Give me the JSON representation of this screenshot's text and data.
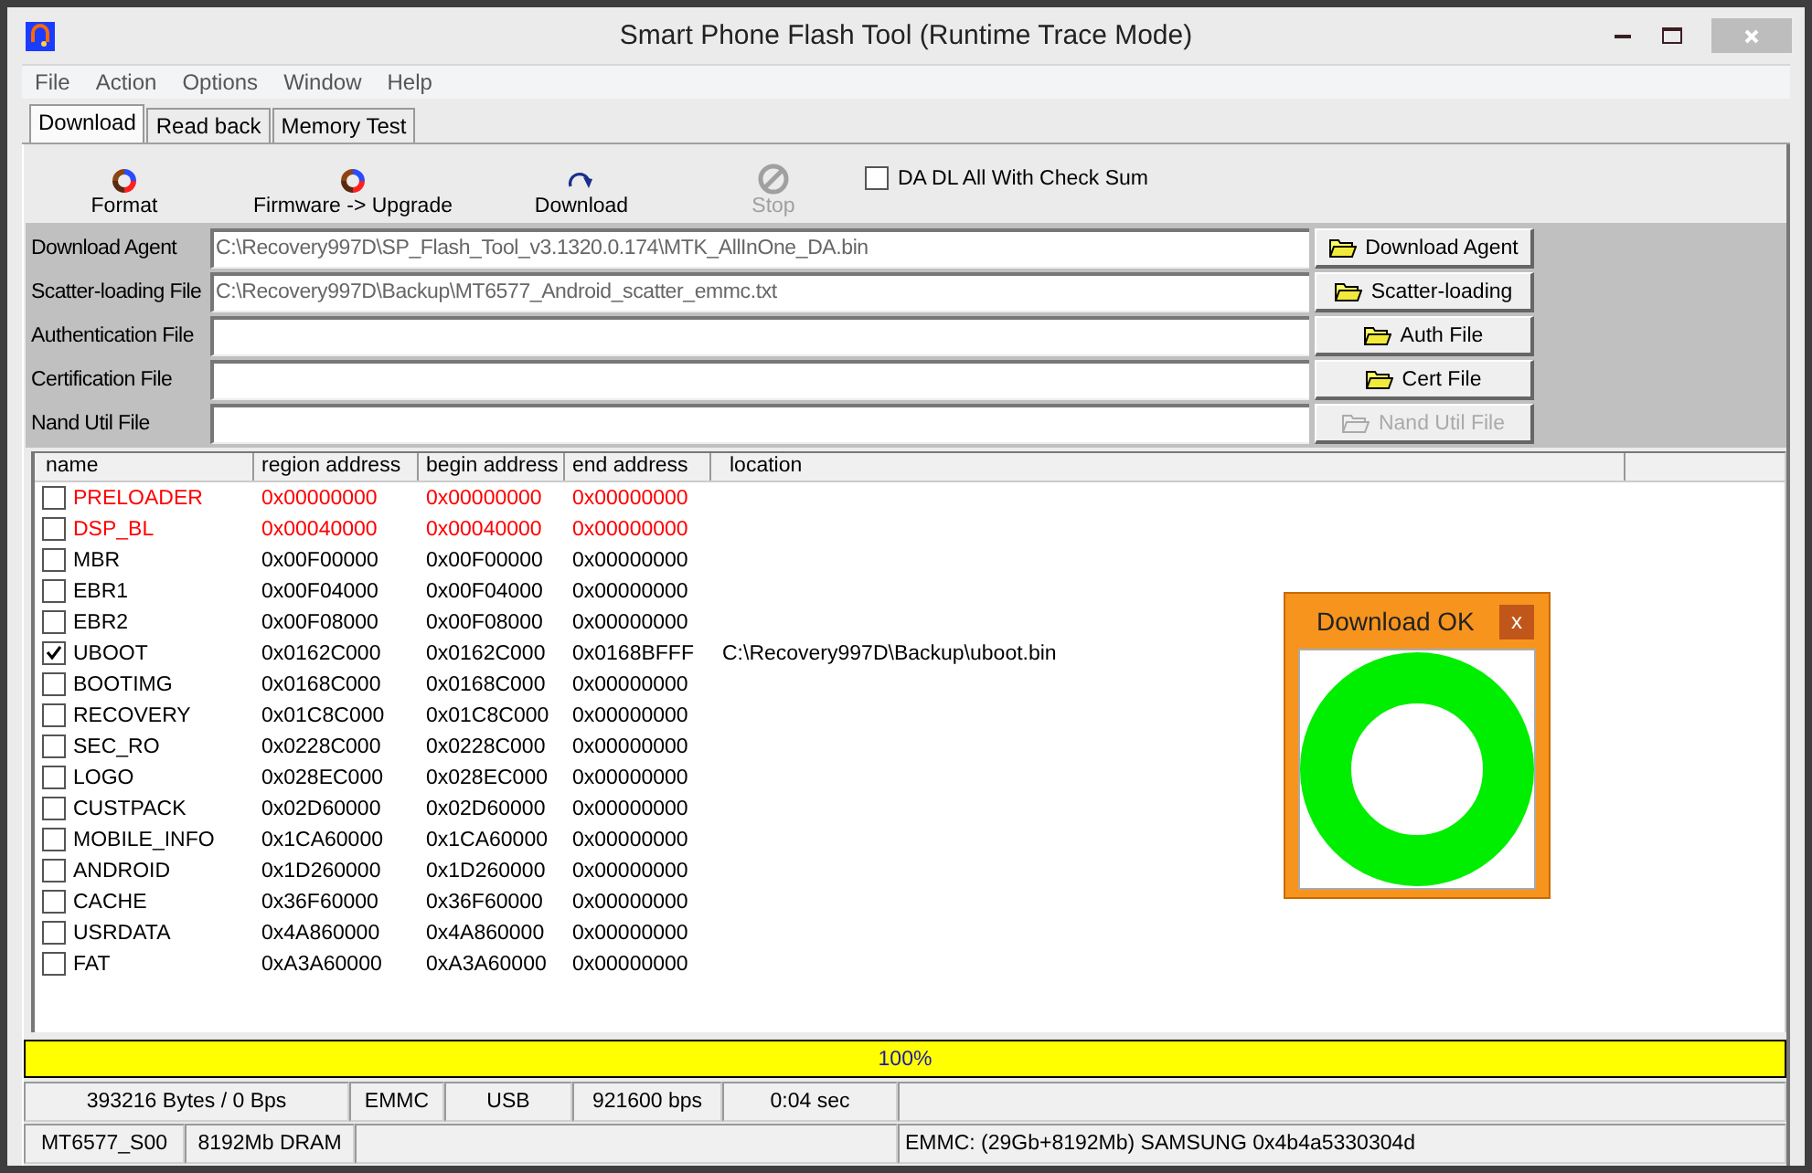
{
  "window": {
    "title": "Smart Phone Flash Tool (Runtime Trace Mode)"
  },
  "menu": [
    "File",
    "Action",
    "Options",
    "Window",
    "Help"
  ],
  "tabs": [
    {
      "label": "Download",
      "selected": true
    },
    {
      "label": "Read back",
      "selected": false
    },
    {
      "label": "Memory Test",
      "selected": false
    }
  ],
  "toolbar": [
    {
      "label": "Format",
      "kind": "format",
      "disabled": false
    },
    {
      "label": "Firmware -> Upgrade",
      "kind": "upgrade",
      "disabled": false
    },
    {
      "label": "Download",
      "kind": "download",
      "disabled": false
    },
    {
      "label": "Stop",
      "kind": "stop",
      "disabled": true
    }
  ],
  "checksum": {
    "label": "DA DL All With Check Sum",
    "checked": false
  },
  "files": [
    {
      "label": "Download Agent",
      "value": "C:\\Recovery997D\\SP_Flash_Tool_v3.1320.0.174\\MTK_AllInOne_DA.bin",
      "button": "Download Agent",
      "disabled": false
    },
    {
      "label": "Scatter-loading File",
      "value": "C:\\Recovery997D\\Backup\\MT6577_Android_scatter_emmc.txt",
      "button": "Scatter-loading",
      "disabled": false
    },
    {
      "label": "Authentication File",
      "button": "Auth File",
      "disabled": false
    },
    {
      "label": "Certification File",
      "button": "Cert File",
      "disabled": false
    },
    {
      "label": "Nand Util File",
      "button": "Nand Util File",
      "disabled": true
    }
  ],
  "table": {
    "columns": [
      "name",
      "region address",
      "begin address",
      "end address",
      "location"
    ],
    "rows": [
      {
        "name": "PRELOADER",
        "region": "0x00000000",
        "begin": "0x00000000",
        "end": "0x00000000",
        "checked": false,
        "color": "#ff0000"
      },
      {
        "name": "DSP_BL",
        "region": "0x00040000",
        "begin": "0x00040000",
        "end": "0x00000000",
        "checked": false,
        "color": "#ff0000"
      },
      {
        "name": "MBR",
        "region": "0x00F00000",
        "begin": "0x00F00000",
        "end": "0x00000000",
        "checked": false,
        "color": "#000000"
      },
      {
        "name": "EBR1",
        "region": "0x00F04000",
        "begin": "0x00F04000",
        "end": "0x00000000",
        "checked": false,
        "color": "#000000"
      },
      {
        "name": "EBR2",
        "region": "0x00F08000",
        "begin": "0x00F08000",
        "end": "0x00000000",
        "checked": false,
        "color": "#000000"
      },
      {
        "name": "UBOOT",
        "region": "0x0162C000",
        "begin": "0x0162C000",
        "end": "0x0168BFFF",
        "location": "C:\\Recovery997D\\Backup\\uboot.bin",
        "checked": true,
        "color": "#000000"
      },
      {
        "name": "BOOTIMG",
        "region": "0x0168C000",
        "begin": "0x0168C000",
        "end": "0x00000000",
        "checked": false,
        "color": "#000000"
      },
      {
        "name": "RECOVERY",
        "region": "0x01C8C000",
        "begin": "0x01C8C000",
        "end": "0x00000000",
        "checked": false,
        "color": "#000000"
      },
      {
        "name": "SEC_RO",
        "region": "0x0228C000",
        "begin": "0x0228C000",
        "end": "0x00000000",
        "checked": false,
        "color": "#000000"
      },
      {
        "name": "LOGO",
        "region": "0x028EC000",
        "begin": "0x028EC000",
        "end": "0x00000000",
        "checked": false,
        "color": "#000000"
      },
      {
        "name": "CUSTPACK",
        "region": "0x02D60000",
        "begin": "0x02D60000",
        "end": "0x00000000",
        "checked": false,
        "color": "#000000"
      },
      {
        "name": "MOBILE_INFO",
        "region": "0x1CA60000",
        "begin": "0x1CA60000",
        "end": "0x00000000",
        "checked": false,
        "color": "#000000"
      },
      {
        "name": "ANDROID",
        "region": "0x1D260000",
        "begin": "0x1D260000",
        "end": "0x00000000",
        "checked": false,
        "color": "#000000"
      },
      {
        "name": "CACHE",
        "region": "0x36F60000",
        "begin": "0x36F60000",
        "end": "0x00000000",
        "checked": false,
        "color": "#000000"
      },
      {
        "name": "USRDATA",
        "region": "0x4A860000",
        "begin": "0x4A860000",
        "end": "0x00000000",
        "checked": false,
        "color": "#000000"
      },
      {
        "name": "FAT",
        "region": "0xA3A60000",
        "begin": "0xA3A60000",
        "end": "0x00000000",
        "checked": false,
        "color": "#000000"
      }
    ]
  },
  "popup": {
    "title": "Download OK",
    "close": "x"
  },
  "progress": {
    "level": 1,
    "text": "100%"
  },
  "status_bar": [
    [
      "393216 Bytes / 0 Bps",
      "EMMC",
      "USB",
      "921600 bps",
      "0:04 sec"
    ],
    [
      "MT6577_S00",
      "8192Mb DRAM",
      "EMMC: (29Gb+8192Mb) SAMSUNG 0x4b4a5330304d"
    ]
  ]
}
